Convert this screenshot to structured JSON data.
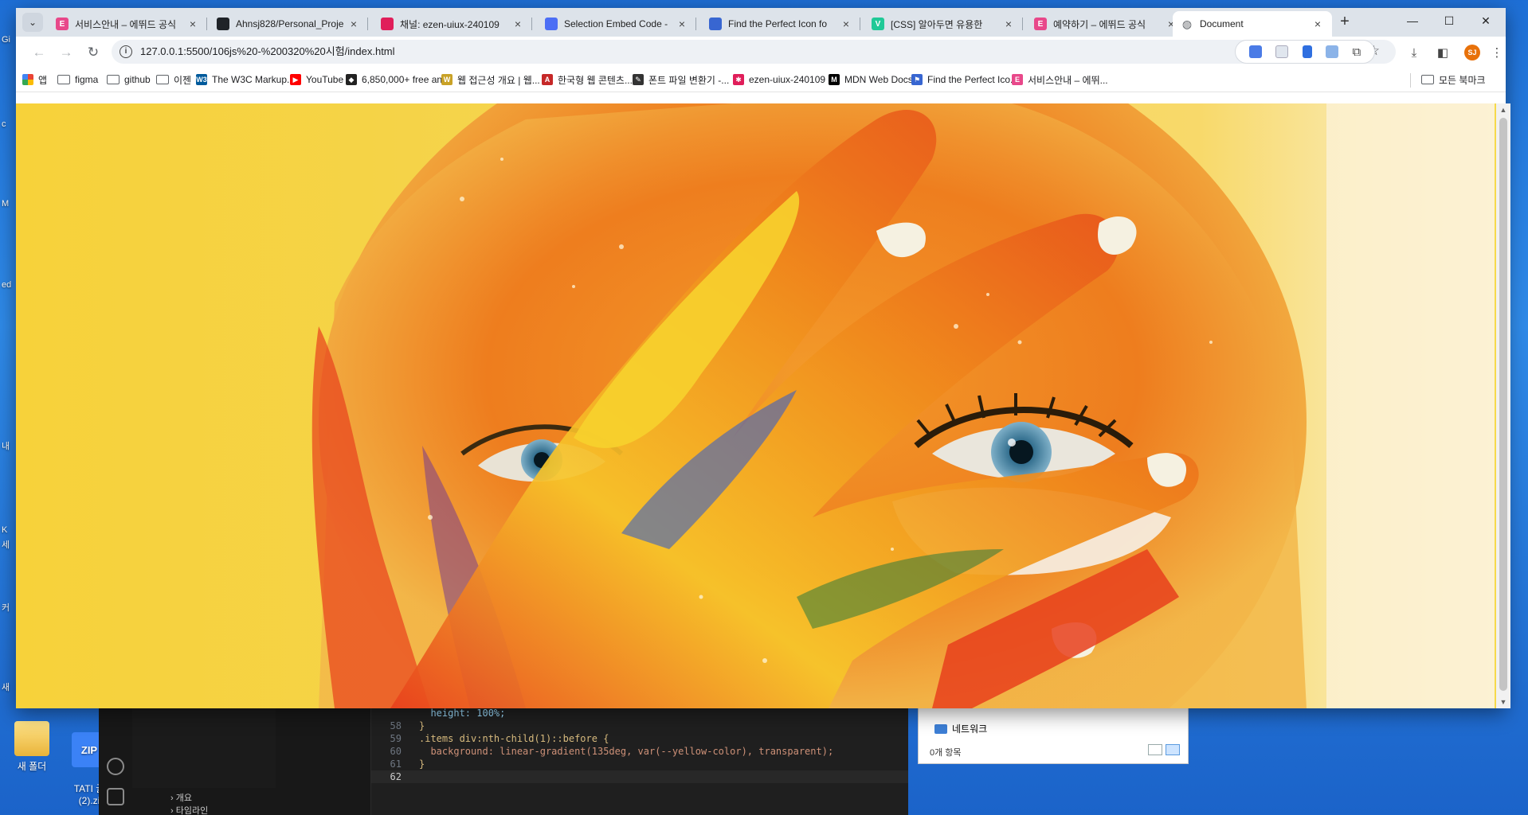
{
  "desktop": {
    "icons": [
      {
        "label": "새 폴더"
      },
      {
        "label": "TATI 글\n(2).zi"
      }
    ],
    "edge_labels": [
      "Gi",
      "c",
      "M",
      "ed",
      "내",
      "K",
      "세",
      "커",
      "새"
    ]
  },
  "vscode": {
    "lines": [
      {
        "num": "",
        "text": "  height: 100%;"
      },
      {
        "num": "58",
        "text": "}"
      },
      {
        "num": "59",
        "text": ".items div:nth-child(1)::before {"
      },
      {
        "num": "60",
        "text": "  background: linear-gradient(135deg, var(--yellow-color), transparent);"
      },
      {
        "num": "61",
        "text": "}"
      },
      {
        "num": "62",
        "text": ""
      }
    ],
    "panels": [
      "개요",
      "타임라인"
    ]
  },
  "explorer": {
    "network_label": "네트워크",
    "item_count": "0개 항목"
  },
  "browser": {
    "tabs": [
      {
        "title": "서비스안내 – 에뛰드 공식",
        "favicon": "E",
        "color": "#e8488a"
      },
      {
        "title": "Ahnsj828/Personal_Proje",
        "favicon": "gh",
        "color": "#1f2328"
      },
      {
        "title": "채널: ezen-uiux-240109",
        "favicon": "sl",
        "color": "#e01e5a"
      },
      {
        "title": "Selection Embed Code -",
        "favicon": "ic",
        "color": "#4c6ef5"
      },
      {
        "title": "Find the Perfect Icon fo",
        "favicon": "fl",
        "color": "#3866d1"
      },
      {
        "title": "[CSS] 알아두면 유용한",
        "favicon": "V",
        "color": "#20c997"
      },
      {
        "title": "예약하기 – 에뛰드 공식",
        "favicon": "E",
        "color": "#e8488a"
      },
      {
        "title": "Document",
        "favicon": "globe",
        "color": "#5f6368",
        "active": true
      }
    ],
    "new_tab": "+",
    "window_controls": {
      "minimize": "—",
      "maximize": "☐",
      "close": "✕"
    },
    "url": "127.0.0.1:5500/106js%20-%200320%20시험/index.html",
    "bookmarks": [
      {
        "label": "앱",
        "type": "apps"
      },
      {
        "label": "figma",
        "type": "folder"
      },
      {
        "label": "github",
        "type": "folder"
      },
      {
        "label": "이젠",
        "type": "folder"
      },
      {
        "label": "The W3C Markup...",
        "type": "site",
        "icon": "W3",
        "color": "#005a9c"
      },
      {
        "label": "YouTube",
        "type": "site",
        "icon": "▶",
        "color": "#ff0000"
      },
      {
        "label": "6,850,000+ free an...",
        "type": "site",
        "icon": "◆",
        "color": "#222222"
      },
      {
        "label": "웹 접근성 개요 | 웹...",
        "type": "site",
        "icon": "W",
        "color": "#c9a227"
      },
      {
        "label": "한국형 웹 콘텐츠...",
        "type": "site",
        "icon": "A",
        "color": "#c62828"
      },
      {
        "label": "폰트 파일 변환기 -...",
        "type": "site",
        "icon": "✎",
        "color": "#333333"
      },
      {
        "label": "ezen-uiux-240109 -...",
        "type": "site",
        "icon": "✱",
        "color": "#e01e5a"
      },
      {
        "label": "MDN Web Docs",
        "type": "site",
        "icon": "M",
        "color": "#000000"
      },
      {
        "label": "Find the Perfect Ico...",
        "type": "site",
        "icon": "⚑",
        "color": "#3866d1"
      },
      {
        "label": "서비스안내 – 에뛰...",
        "type": "site",
        "icon": "E",
        "color": "#e8488a"
      }
    ],
    "all_bookmarks": "모든 북마크",
    "profile_initials": "SJ"
  },
  "page": {
    "title": "Document",
    "hero_description": "Close-up of a face covered in colorful paint with a painted hand partially covering it"
  },
  "colors": {
    "accent_yellow": "#f7d23a",
    "paint_orange": "#f08a1c",
    "paint_red": "#e8401c"
  }
}
